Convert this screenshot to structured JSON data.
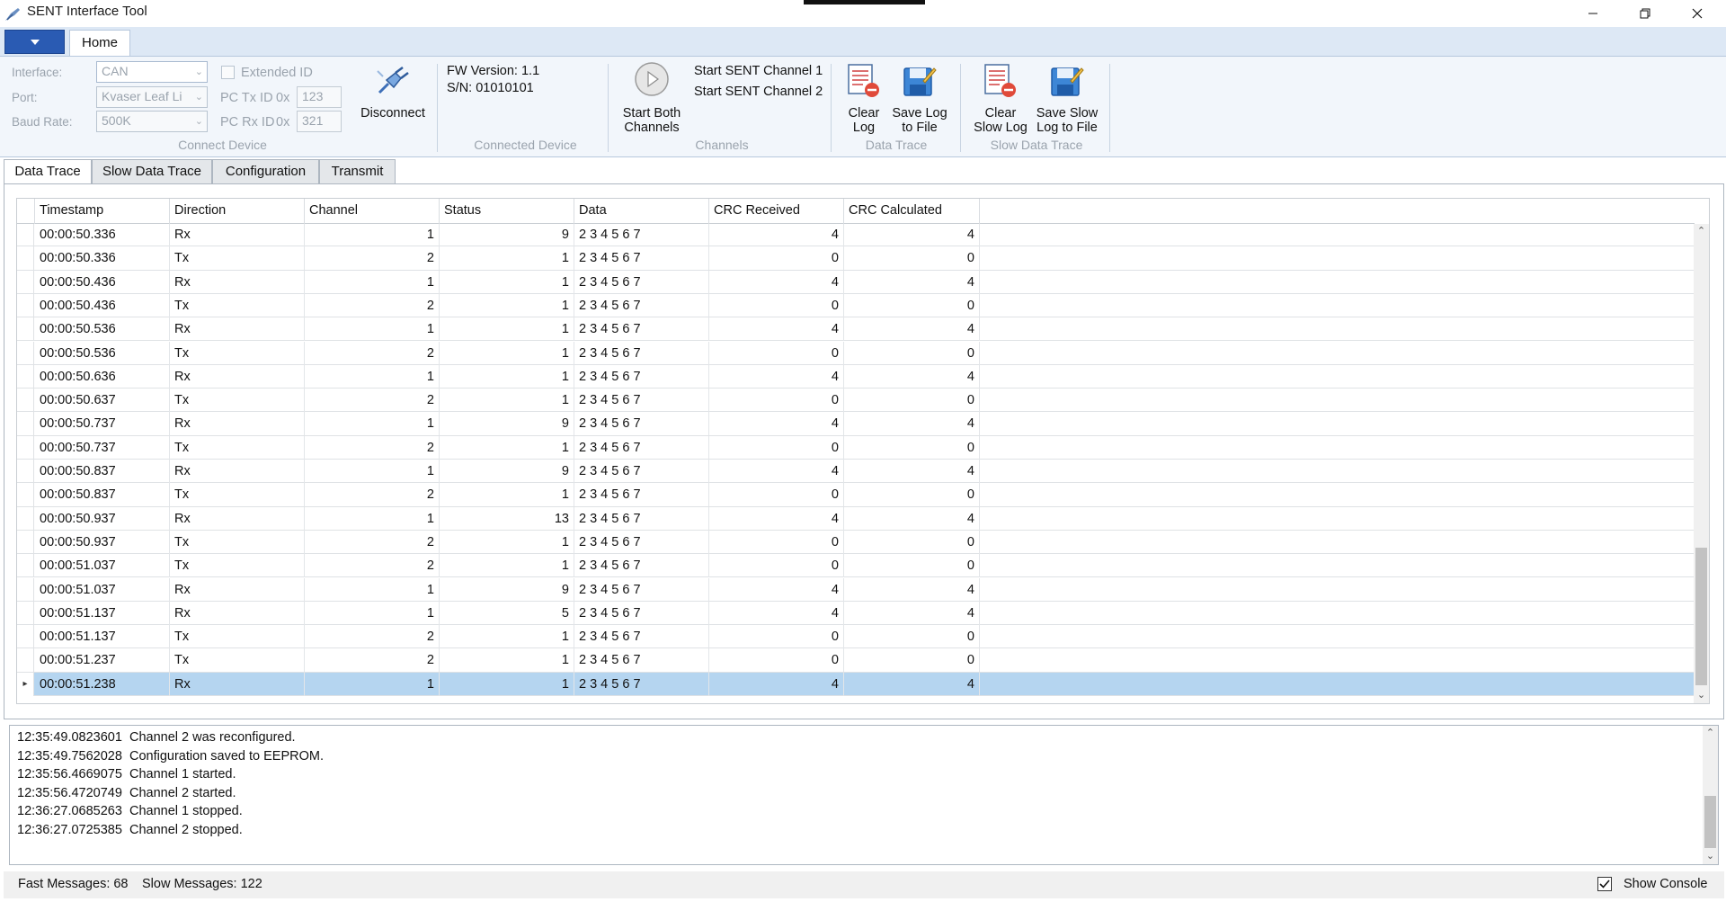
{
  "window": {
    "title": "SENT Interface Tool"
  },
  "ribbon": {
    "tabs": [
      "Home"
    ],
    "connect_device": {
      "group_label": "Connect Device",
      "interface_label": "Interface:",
      "interface_value": "CAN",
      "port_label": "Port:",
      "port_value": "Kvaser Leaf Li",
      "baud_label": "Baud Rate:",
      "baud_value": "500K",
      "extended_id_label": "Extended ID",
      "pc_tx_label": "PC Tx ID",
      "pc_tx_prefix": "0x",
      "pc_tx_value": "123",
      "pc_rx_label": "PC Rx ID",
      "pc_rx_prefix": "0x",
      "pc_rx_value": "321",
      "disconnect_label": "Disconnect"
    },
    "connected_device": {
      "group_label": "Connected Device",
      "fw_version": "FW Version: 1.1",
      "serial": "S/N: 01010101"
    },
    "channels": {
      "group_label": "Channels",
      "start_both_line1": "Start Both",
      "start_both_line2": "Channels",
      "start_ch1": "Start SENT Channel 1",
      "start_ch2": "Start SENT Channel 2"
    },
    "data_trace": {
      "group_label": "Data Trace",
      "clear_line1": "Clear",
      "clear_line2": "Log",
      "save_line1": "Save Log",
      "save_line2": "to File"
    },
    "slow_data_trace": {
      "group_label": "Slow Data Trace",
      "clear_line1": "Clear",
      "clear_line2": "Slow Log",
      "save_line1": "Save Slow",
      "save_line2": "Log to File"
    }
  },
  "doc_tabs": [
    "Data Trace",
    "Slow Data Trace",
    "Configuration",
    "Transmit"
  ],
  "grid": {
    "columns": [
      "Timestamp",
      "Direction",
      "Channel",
      "Status",
      "Data",
      "CRC Received",
      "CRC Calculated"
    ],
    "rows": [
      [
        "00:00:50.336",
        "Rx",
        "1",
        "9",
        "2 3 4 5 6 7",
        "4",
        "4"
      ],
      [
        "00:00:50.336",
        "Tx",
        "2",
        "1",
        "2 3 4 5 6 7",
        "0",
        "0"
      ],
      [
        "00:00:50.436",
        "Rx",
        "1",
        "1",
        "2 3 4 5 6 7",
        "4",
        "4"
      ],
      [
        "00:00:50.436",
        "Tx",
        "2",
        "1",
        "2 3 4 5 6 7",
        "0",
        "0"
      ],
      [
        "00:00:50.536",
        "Rx",
        "1",
        "1",
        "2 3 4 5 6 7",
        "4",
        "4"
      ],
      [
        "00:00:50.536",
        "Tx",
        "2",
        "1",
        "2 3 4 5 6 7",
        "0",
        "0"
      ],
      [
        "00:00:50.636",
        "Rx",
        "1",
        "1",
        "2 3 4 5 6 7",
        "4",
        "4"
      ],
      [
        "00:00:50.637",
        "Tx",
        "2",
        "1",
        "2 3 4 5 6 7",
        "0",
        "0"
      ],
      [
        "00:00:50.737",
        "Rx",
        "1",
        "9",
        "2 3 4 5 6 7",
        "4",
        "4"
      ],
      [
        "00:00:50.737",
        "Tx",
        "2",
        "1",
        "2 3 4 5 6 7",
        "0",
        "0"
      ],
      [
        "00:00:50.837",
        "Rx",
        "1",
        "9",
        "2 3 4 5 6 7",
        "4",
        "4"
      ],
      [
        "00:00:50.837",
        "Tx",
        "2",
        "1",
        "2 3 4 5 6 7",
        "0",
        "0"
      ],
      [
        "00:00:50.937",
        "Rx",
        "1",
        "13",
        "2 3 4 5 6 7",
        "4",
        "4"
      ],
      [
        "00:00:50.937",
        "Tx",
        "2",
        "1",
        "2 3 4 5 6 7",
        "0",
        "0"
      ],
      [
        "00:00:51.037",
        "Tx",
        "2",
        "1",
        "2 3 4 5 6 7",
        "0",
        "0"
      ],
      [
        "00:00:51.037",
        "Rx",
        "1",
        "9",
        "2 3 4 5 6 7",
        "4",
        "4"
      ],
      [
        "00:00:51.137",
        "Rx",
        "1",
        "5",
        "2 3 4 5 6 7",
        "4",
        "4"
      ],
      [
        "00:00:51.137",
        "Tx",
        "2",
        "1",
        "2 3 4 5 6 7",
        "0",
        "0"
      ],
      [
        "00:00:51.237",
        "Tx",
        "2",
        "1",
        "2 3 4 5 6 7",
        "0",
        "0"
      ],
      [
        "00:00:51.238",
        "Rx",
        "1",
        "1",
        "2 3 4 5 6 7",
        "4",
        "4"
      ]
    ],
    "selected_row": 19
  },
  "console": [
    {
      "ts": "12:35:49.0823601",
      "msg": "Channel 2 was reconfigured."
    },
    {
      "ts": "12:35:49.7562028",
      "msg": "Configuration saved to EEPROM."
    },
    {
      "ts": "12:35:56.4669075",
      "msg": "Channel 1 started."
    },
    {
      "ts": "12:35:56.4720749",
      "msg": "Channel 2 started."
    },
    {
      "ts": "12:36:27.0685263",
      "msg": "Channel 1 stopped."
    },
    {
      "ts": "12:36:27.0725385",
      "msg": "Channel 2 stopped."
    }
  ],
  "status": {
    "fast_messages": "Fast Messages: 68",
    "slow_messages": "Slow Messages: 122",
    "show_console_label": "Show Console",
    "show_console_checked": true
  },
  "colors": {
    "selection": "#b5d5f0",
    "file_button": "#2a5bb3",
    "ribbon_bg": "#f2f6fb"
  }
}
